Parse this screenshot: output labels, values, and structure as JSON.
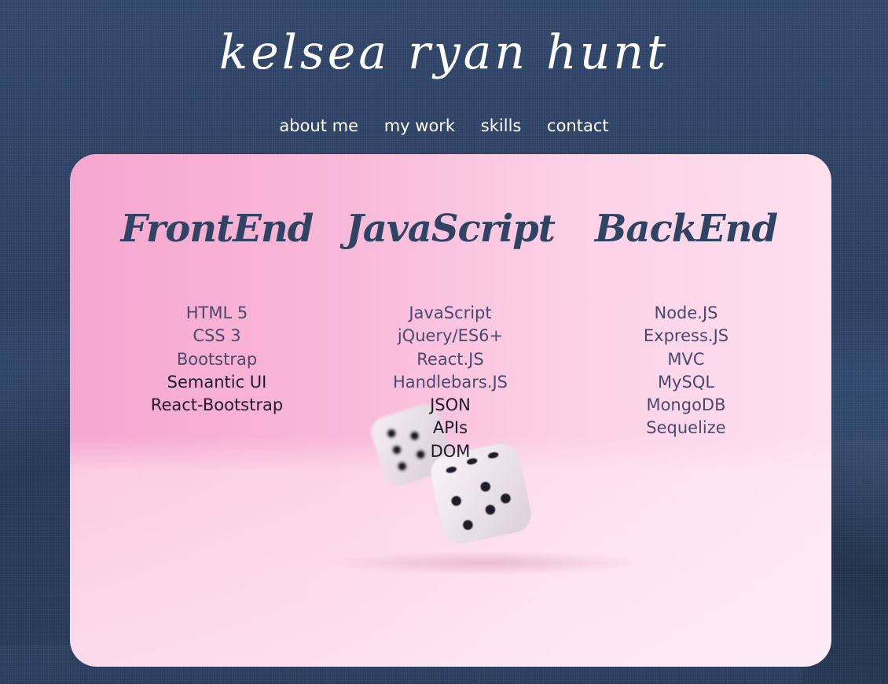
{
  "site": {
    "title": "kelsea ryan hunt"
  },
  "nav": {
    "items": [
      {
        "label": "about me"
      },
      {
        "label": "my work"
      },
      {
        "label": "skills"
      },
      {
        "label": "contact"
      }
    ]
  },
  "skills": {
    "frontend": {
      "heading": "FrontEnd",
      "items": [
        "HTML 5",
        "CSS 3",
        "Bootstrap",
        "Semantic UI",
        "React-Bootstrap"
      ]
    },
    "javascript": {
      "heading": "JavaScript",
      "items": [
        "JavaScript",
        "jQuery/ES6+",
        "React.JS",
        "Handlebars.JS",
        "JSON",
        "APIs",
        "DOM"
      ]
    },
    "backend": {
      "heading": "BackEnd",
      "items": [
        "Node.JS",
        "Express.JS",
        "MVC",
        "MySQL",
        "MongoDB",
        "Sequelize"
      ]
    }
  },
  "colors": {
    "background": "#2e4466",
    "heading": "#2f4462",
    "card_pink": "#f9b8d9",
    "text_white": "#ffffff"
  }
}
